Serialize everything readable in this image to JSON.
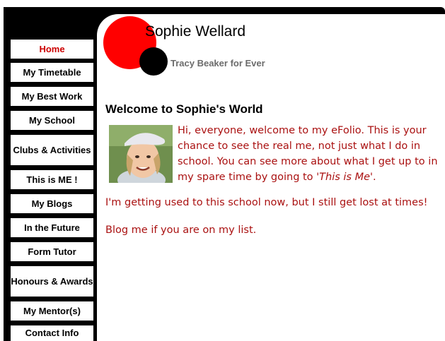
{
  "site": {
    "title": "Sophie Wellard",
    "tagline": "Tracy Beaker for Ever"
  },
  "nav": {
    "items": [
      {
        "label": "Home",
        "active": true
      },
      {
        "label": "My Timetable"
      },
      {
        "label": "My Best Work"
      },
      {
        "label": "My School"
      },
      {
        "label": "Clubs & Activities"
      },
      {
        "label": "This is ME !"
      },
      {
        "label": "My Blogs"
      },
      {
        "label": "In the Future"
      },
      {
        "label": "Form Tutor"
      },
      {
        "label": "Honours & Awards"
      },
      {
        "label": "My Mentor(s)"
      },
      {
        "label": "Contact Info"
      }
    ]
  },
  "main": {
    "heading": "Welcome to Sophie's World",
    "intro_text": "Hi, everyone, welcome to my eFolio.  This is your chance to see the real me, not just what I do in school.  You can see more about what I get up to in my spare time by going to ",
    "intro_link": "'This is Me'",
    "intro_end": ".",
    "para2": "I'm getting used to this school now, but I still get lost at times!",
    "para3": "Blog me if you are on my list."
  },
  "colors": {
    "accent_red": "#ff0000",
    "text_red": "#aa1111",
    "frame": "#000000"
  }
}
